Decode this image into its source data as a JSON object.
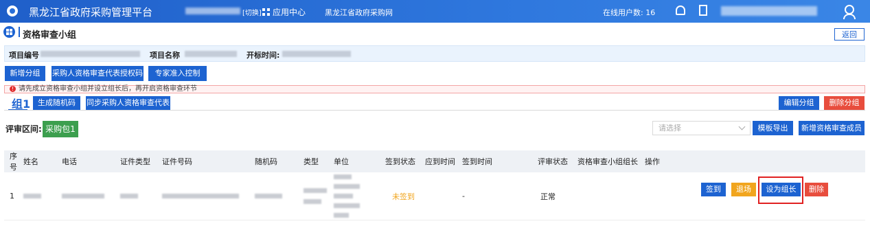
{
  "header": {
    "title": "黑龙江省政府采购管理平台",
    "switch_label": "[切换]",
    "app_center": "应用中心",
    "network_link": "黑龙江省政府采购网",
    "online_users": "在线用户数: 16"
  },
  "page": {
    "title": "资格审查小组",
    "back_label": "返回"
  },
  "project": {
    "number_label": "项目编号",
    "name_label": "项目名称",
    "open_time_label": "开标时间:"
  },
  "actions": {
    "new_group": "新增分组",
    "authorize_rep": "采购人资格审查代表授权码",
    "expert_access": "专家准入控制"
  },
  "alert": {
    "icon": "!",
    "text": "请先成立资格审查小组并设立组长后，再开启资格审查环节"
  },
  "group": {
    "tab_label": "组1",
    "gen_random_code": "生成随机码",
    "sync_rep": "同步采购人资格审查代表",
    "edit_group": "编辑分组",
    "delete_group": "删除分组"
  },
  "review": {
    "range_label": "评审区间:",
    "package": "采购包1",
    "select_placeholder": "请选择",
    "template_export": "模板导出",
    "add_member": "新增资格审查成员"
  },
  "table": {
    "headers": [
      "序号",
      "姓名",
      "电话",
      "证件类型",
      "证件号码",
      "随机码",
      "类型",
      "单位",
      "签到状态",
      "应到时间",
      "签到时间",
      "评审状态",
      "资格审查小组组长",
      "操作"
    ],
    "rows": [
      {
        "index": "1",
        "sign_status": "未签到",
        "sign_time": "-",
        "review_status": "正常",
        "ops": {
          "sign_in": "签到",
          "withdraw": "退场",
          "set_leader": "设为组长",
          "delete": "删除"
        }
      }
    ]
  },
  "colors": {
    "primary": "#1d63d1",
    "danger": "#e84d3d",
    "warning": "#f1a51e",
    "success": "#3c9f4e"
  }
}
